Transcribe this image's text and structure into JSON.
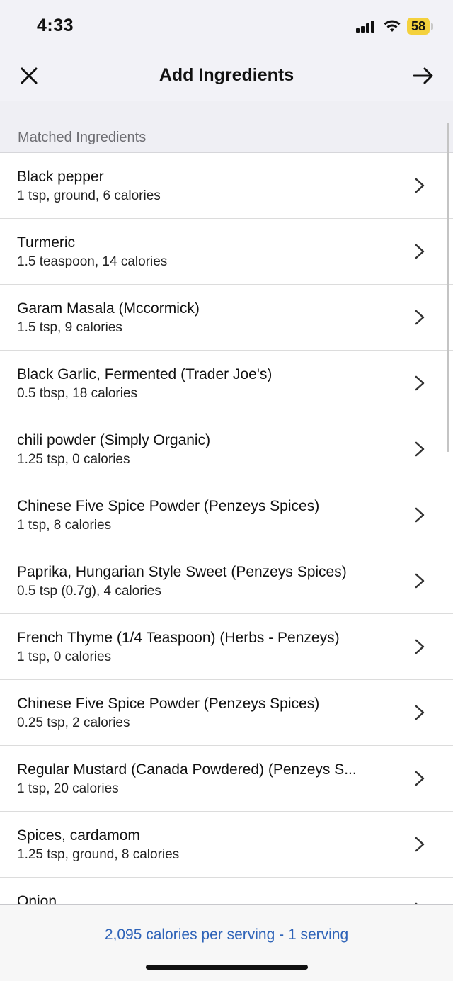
{
  "status_bar": {
    "time": "4:33",
    "battery": "58",
    "icons": [
      "signal-icon",
      "wifi-icon",
      "battery-icon"
    ]
  },
  "nav": {
    "title": "Add Ingredients",
    "close_icon": "close-icon",
    "next_icon": "arrow-right-icon"
  },
  "section": {
    "title": "Matched Ingredients"
  },
  "ingredients": [
    {
      "name": "Black pepper",
      "detail": "1 tsp, ground, 6 calories"
    },
    {
      "name": "Turmeric",
      "detail": "1.5 teaspoon, 14 calories"
    },
    {
      "name": "Garam Masala (Mccormick)",
      "detail": "1.5 tsp, 9 calories"
    },
    {
      "name": "Black Garlic, Fermented (Trader Joe's)",
      "detail": "0.5 tbsp, 18 calories"
    },
    {
      "name": "chili powder (Simply Organic)",
      "detail": "1.25 tsp, 0 calories"
    },
    {
      "name": "Chinese Five Spice Powder (Penzeys Spices)",
      "detail": "1 tsp, 8 calories"
    },
    {
      "name": "Paprika, Hungarian Style Sweet (Penzeys Spices)",
      "detail": "0.5 tsp (0.7g), 4 calories"
    },
    {
      "name": "French Thyme (1/4 Teaspoon) (Herbs - Penzeys)",
      "detail": "1 tsp, 0 calories"
    },
    {
      "name": "Chinese Five Spice Powder (Penzeys Spices)",
      "detail": "0.25 tsp, 2 calories"
    },
    {
      "name": "Regular Mustard (Canada Powdered) (Penzeys S...",
      "detail": "1 tsp, 20 calories"
    },
    {
      "name": "Spices, cardamom",
      "detail": "1.25 tsp, ground, 8 calories"
    },
    {
      "name": "Onion",
      "detail": ""
    }
  ],
  "footer": {
    "summary": "2,095 calories per serving - 1 serving"
  },
  "colors": {
    "accent": "#2e63b8",
    "battery": "#f4d13d",
    "header_bg": "#f2f2f7"
  }
}
